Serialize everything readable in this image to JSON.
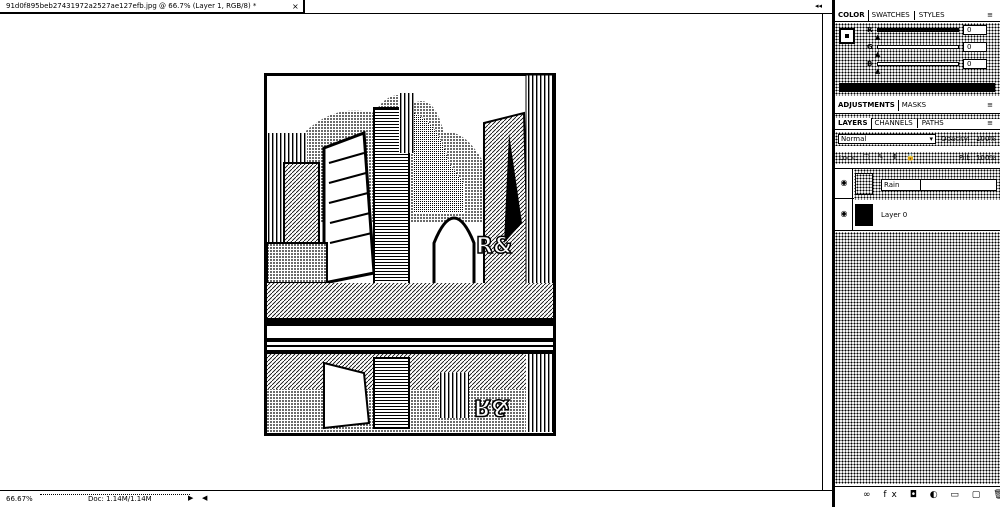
{
  "document": {
    "tab_title": "91d0f895beb27431972a2527ae127efb.jpg @ 66.7% (Layer 1, RGB/8) *",
    "close_glyph": "×",
    "image_description_icon": "city-street-with-reflection-image"
  },
  "status_bar": {
    "zoom": "66.67%",
    "doc_size": "Doc: 1.14M/1.14M",
    "menu_arrow": "▶",
    "scroll_left_arrow": "◀"
  },
  "panels": {
    "collapse_arrows": "◂◂",
    "color_tabs": [
      "COLOR",
      "SWATCHES",
      "STYLES"
    ],
    "color": {
      "channels": [
        {
          "label": "R",
          "value": "0",
          "fill": 0.0
        },
        {
          "label": "G",
          "value": "0",
          "fill": 0.0
        },
        {
          "label": "B",
          "value": "0",
          "fill": 0.0
        }
      ],
      "foreground": "#000000"
    },
    "adjustment_tabs": [
      "ADJUSTMENTS",
      "MASKS"
    ],
    "layer_tabs": [
      "LAYERS",
      "CHANNELS",
      "PATHS"
    ],
    "menu_glyph": "≡",
    "layers": {
      "blend_mode": "Normal",
      "opacity_label": "Opacity:",
      "opacity_value": "100%",
      "lock_label": "Lock:",
      "lock_icons": "□ ✎ ✥ 🔒",
      "fill_label": "Fill:",
      "fill_value": "100%",
      "items": [
        {
          "name": "Rain",
          "editing": true
        },
        {
          "name": "Layer 0",
          "editing": false
        }
      ],
      "footer_icons": "∞ fx ◘ ◐ ▭ ▢ 🗑"
    }
  }
}
